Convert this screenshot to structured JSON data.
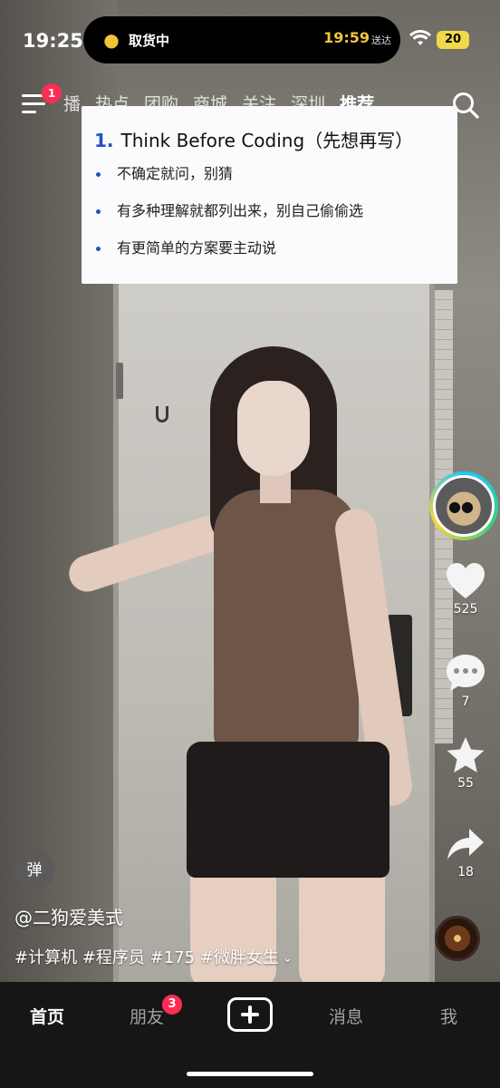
{
  "status_bar": {
    "time": "19:25",
    "island": {
      "icon": "delivery-scooter-icon",
      "label": "取货中",
      "eta": "19:59",
      "eta_suffix": "送达"
    },
    "wifi_icon": "wifi-icon",
    "battery": "20",
    "battery_color": "#f2d84a"
  },
  "top_nav": {
    "menu_icon": "hamburger-menu-icon",
    "menu_badge": "1",
    "tabs": [
      {
        "label": "播"
      },
      {
        "label": "热点"
      },
      {
        "label": "团购"
      },
      {
        "label": "商城"
      },
      {
        "label": "关注"
      },
      {
        "label": "深圳"
      },
      {
        "label": "推荐"
      }
    ],
    "active_tab": "推荐",
    "search_icon": "search-icon"
  },
  "slide": {
    "number": "1.",
    "title": "Think Before Coding（先想再写）",
    "bullets": [
      "不确定就问，别猜",
      "有多种理解就都列出来，别自己偷偷选",
      "有更简单的方案要主动说"
    ],
    "accent_color": "#2351c2"
  },
  "actions": {
    "like_count": "525",
    "comment_count": "7",
    "favorite_count": "55",
    "share_count": "18"
  },
  "video_info": {
    "danmu_label": "弹",
    "author": "@二狗爱美式",
    "hashtags": "#计算机 #程序员 #175 #微胖女生"
  },
  "bottom_nav": {
    "items": [
      "首页",
      "朋友",
      "消息",
      "我"
    ],
    "friends_badge": "3",
    "badge_color": "#fe2c55"
  }
}
